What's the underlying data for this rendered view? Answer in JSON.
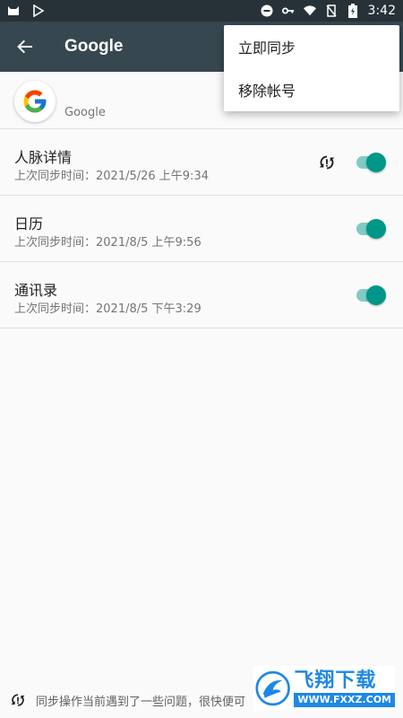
{
  "status_bar": {
    "time": "3:42",
    "icons": [
      "cat-notification-icon",
      "play-store-icon",
      "do-not-disturb-icon",
      "vpn-key-icon",
      "wifi-icon",
      "no-sim-icon",
      "battery-charging-icon"
    ]
  },
  "app_bar": {
    "title": "Google",
    "back_icon": "arrow-back-icon"
  },
  "account": {
    "name": "Google",
    "logo_icon": "google-g-logo"
  },
  "overflow_menu": {
    "items": [
      {
        "label": "立即同步"
      },
      {
        "label": "移除帐号"
      }
    ]
  },
  "sync_items": [
    {
      "label": "人脉详情",
      "last_sync": "上次同步时间：2021/5/26 上午9:34",
      "enabled": true,
      "error": true
    },
    {
      "label": "日历",
      "last_sync": "上次同步时间：2021/8/5 上午9:56",
      "enabled": true,
      "error": false
    },
    {
      "label": "通讯录",
      "last_sync": "上次同步时间：2021/8/5 下午3:29",
      "enabled": true,
      "error": false
    }
  ],
  "footer": {
    "icon": "sync-problem-icon",
    "message": "同步操作当前遇到了一些问题，很快便可"
  },
  "watermark": {
    "brand": "飞翔下载",
    "url": "WWW.FXXZ.COM"
  },
  "colors": {
    "status_bar": "#263238",
    "app_bar": "#37474f",
    "accent": "#009688",
    "accent_track": "#80cbc4"
  }
}
